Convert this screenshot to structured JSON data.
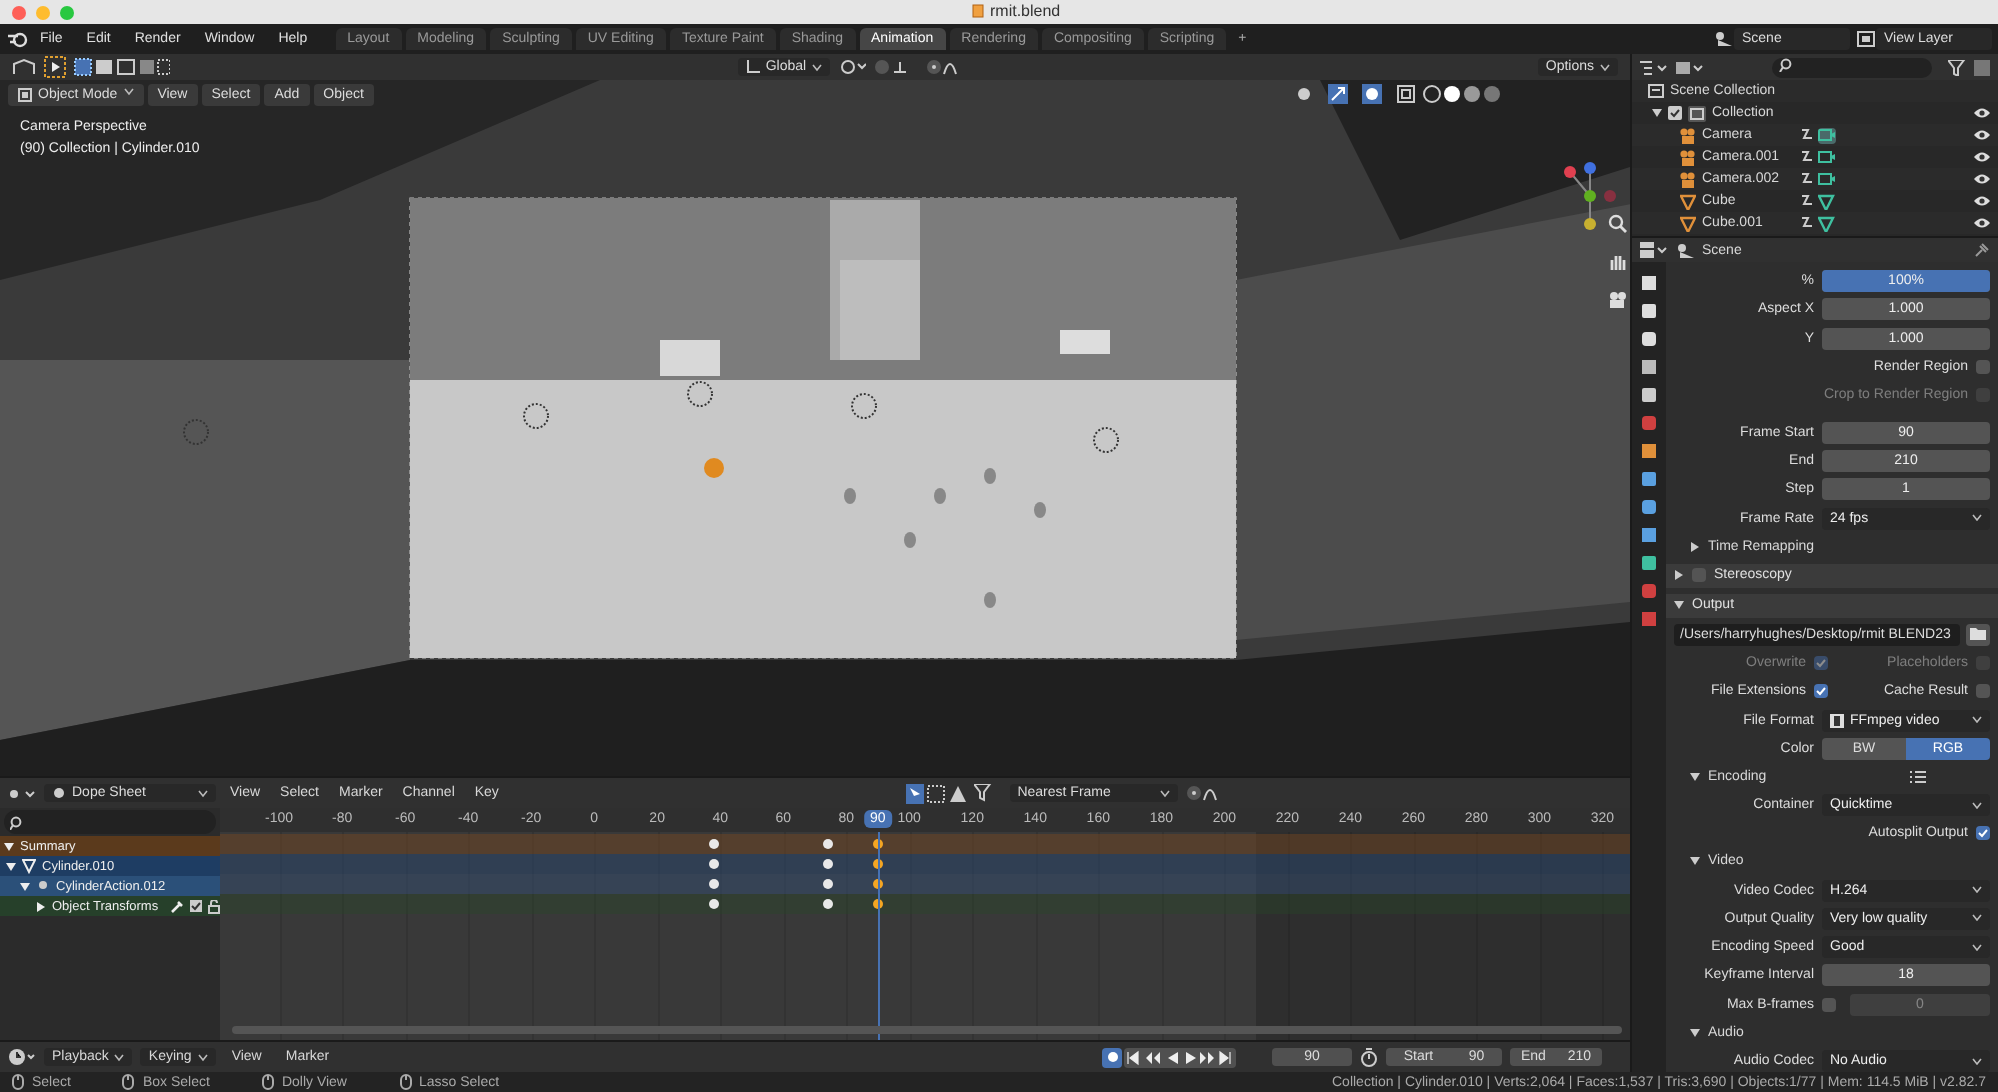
{
  "window": {
    "title": "rmit.blend"
  },
  "menu": [
    "File",
    "Edit",
    "Render",
    "Window",
    "Help"
  ],
  "workspace_tabs": [
    {
      "label": "Layout",
      "selected": false
    },
    {
      "label": "Modeling",
      "selected": false
    },
    {
      "label": "Sculpting",
      "selected": false
    },
    {
      "label": "UV Editing",
      "selected": false
    },
    {
      "label": "Texture Paint",
      "selected": false
    },
    {
      "label": "Shading",
      "selected": false
    },
    {
      "label": "Animation",
      "selected": true
    },
    {
      "label": "Rendering",
      "selected": false
    },
    {
      "label": "Compositing",
      "selected": false
    },
    {
      "label": "Scripting",
      "selected": false
    }
  ],
  "add_tab": "+",
  "scene": {
    "value": "Scene"
  },
  "view_layer": {
    "value": "View Layer"
  },
  "viewport": {
    "transform_orientation": "Global",
    "mode": "Object Mode",
    "menus": [
      "View",
      "Select",
      "Add",
      "Object"
    ],
    "options": "Options",
    "overlay_text": [
      "Camera Perspective",
      "(90) Collection | Cylinder.010"
    ]
  },
  "outliner": {
    "root": "Scene Collection",
    "items": [
      {
        "label": "Collection",
        "kind": "collection",
        "checked": true,
        "expanded": true,
        "children": [
          {
            "label": "Camera",
            "kind": "camera",
            "active": true
          },
          {
            "label": "Camera.001",
            "kind": "camera",
            "active": false
          },
          {
            "label": "Camera.002",
            "kind": "camera",
            "active": false
          },
          {
            "label": "Cube",
            "kind": "mesh",
            "active": false
          },
          {
            "label": "Cube.001",
            "kind": "mesh",
            "active": false
          }
        ]
      }
    ]
  },
  "properties": {
    "context": "Scene",
    "rows": [
      {
        "kind": "slider",
        "label": "%",
        "value": "100%",
        "level": 1
      },
      {
        "kind": "number",
        "label": "Aspect X",
        "value": "1.000"
      },
      {
        "kind": "number",
        "label": "Y",
        "value": "1.000"
      },
      {
        "kind": "check",
        "label": "Render Region",
        "checked": false,
        "disabled": false
      },
      {
        "kind": "check",
        "label": "Crop to Render Region",
        "checked": false,
        "disabled": true
      },
      {
        "kind": "number",
        "label": "Frame Start",
        "value": "90",
        "gap": true
      },
      {
        "kind": "number",
        "label": "End",
        "value": "210"
      },
      {
        "kind": "number",
        "label": "Step",
        "value": "1"
      },
      {
        "kind": "dropdown",
        "label": "Frame Rate",
        "value": "24 fps"
      },
      {
        "kind": "subpanel",
        "label": "Time Remapping",
        "expanded": false
      },
      {
        "kind": "panel",
        "label": "Stereoscopy",
        "expanded": false,
        "checkbox": true,
        "checked": false
      },
      {
        "kind": "panel",
        "label": "Output",
        "expanded": true
      },
      {
        "kind": "path",
        "value": "/Users/harryhughes/Desktop/rmit BLEND23"
      },
      {
        "kind": "checkpair",
        "items": [
          {
            "label": "Overwrite",
            "checked": true,
            "disabled": true
          },
          {
            "label": "Placeholders",
            "checked": false,
            "disabled": true
          }
        ]
      },
      {
        "kind": "checkpair",
        "items": [
          {
            "label": "File Extensions",
            "checked": true,
            "disabled": false
          },
          {
            "label": "Cache Result",
            "checked": false,
            "disabled": false
          }
        ]
      },
      {
        "kind": "dropdown",
        "label": "File Format",
        "value": "FFmpeg video",
        "icon": true
      },
      {
        "kind": "toggle",
        "label": "Color",
        "options": [
          {
            "label": "BW",
            "selected": false
          },
          {
            "label": "RGB",
            "selected": true
          }
        ]
      },
      {
        "kind": "subpanel",
        "label": "Encoding",
        "expanded": true,
        "menu": true
      },
      {
        "kind": "dropdown",
        "label": "Container",
        "value": "Quicktime"
      },
      {
        "kind": "check",
        "label": "Autosplit Output",
        "checked": true,
        "disabled": false
      },
      {
        "kind": "subpanel",
        "label": "Video",
        "expanded": true
      },
      {
        "kind": "dropdown",
        "label": "Video Codec",
        "value": "H.264"
      },
      {
        "kind": "dropdown",
        "label": "Output Quality",
        "value": "Very low quality"
      },
      {
        "kind": "dropdown",
        "label": "Encoding Speed",
        "value": "Good"
      },
      {
        "kind": "number",
        "label": "Keyframe Interval",
        "value": "18"
      },
      {
        "kind": "check_number",
        "label": "Max B-frames",
        "checked": false,
        "value": "0"
      },
      {
        "kind": "subpanel",
        "label": "Audio",
        "expanded": true
      },
      {
        "kind": "dropdown",
        "label": "Audio Codec",
        "value": "No Audio"
      }
    ]
  },
  "dope_sheet": {
    "mode": "Dope Sheet",
    "menus": [
      "View",
      "Select",
      "Marker",
      "Channel",
      "Key"
    ],
    "snap": "Nearest Frame",
    "current_frame": "90",
    "ruler": [
      "-100",
      "-80",
      "-60",
      "-40",
      "-20",
      "0",
      "20",
      "40",
      "60",
      "80",
      "100",
      "120",
      "140",
      "160",
      "180",
      "200",
      "220",
      "240",
      "260",
      "280",
      "300",
      "320"
    ],
    "channels": [
      {
        "label": "Summary",
        "kind": "summary",
        "expanded": true,
        "keys": [
          {
            "selected": false
          },
          {
            "selected": false
          },
          {
            "selected": true
          }
        ]
      },
      {
        "label": "Cylinder.010",
        "kind": "object",
        "expanded": true,
        "keys": [
          {
            "selected": false
          },
          {
            "selected": false
          },
          {
            "selected": true
          }
        ]
      },
      {
        "label": "CylinderAction.012",
        "kind": "action",
        "expanded": true,
        "keys": [
          {
            "selected": false
          },
          {
            "selected": false
          },
          {
            "selected": true
          }
        ]
      },
      {
        "label": "Object Transforms",
        "kind": "group",
        "expanded": false,
        "keys": [
          {
            "selected": false
          },
          {
            "selected": false
          },
          {
            "selected": true
          }
        ]
      }
    ]
  },
  "timeline": {
    "menus": [
      {
        "label": "Playback",
        "dropdown": true
      },
      {
        "label": "Keying",
        "dropdown": true
      },
      {
        "label": "View",
        "dropdown": false
      },
      {
        "label": "Marker",
        "dropdown": false
      }
    ],
    "auto_key": true,
    "frame": "90",
    "start_label": "Start",
    "start": "90",
    "end_label": "End",
    "end": "210"
  },
  "status_bar": {
    "hints": [
      "Select",
      "Box Select",
      "Dolly View",
      "Lasso Select"
    ],
    "stats": "Collection | Cylinder.010 | Verts:2,064 | Faces:1,537 | Tris:3,690 | Objects:1/77 | Mem: 114.5 MiB | v2.82.7"
  }
}
